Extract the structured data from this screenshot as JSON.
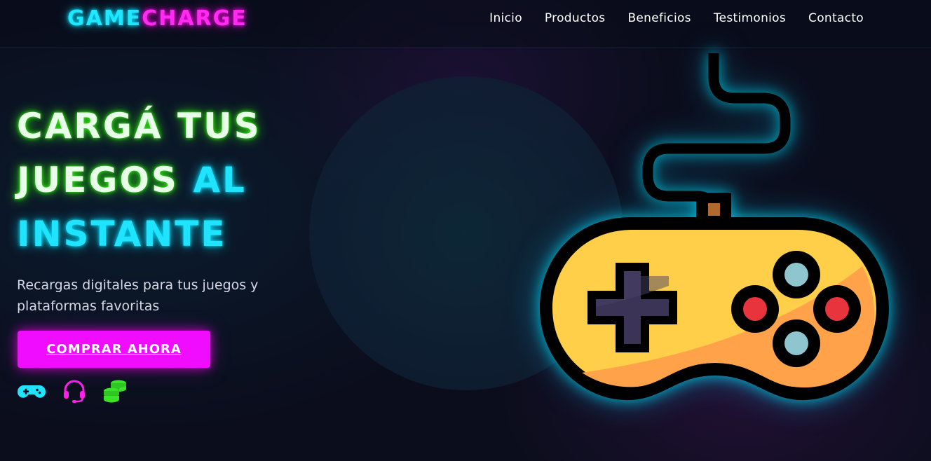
{
  "brand": {
    "part1": "GAME",
    "part2": "CHARGE"
  },
  "nav": {
    "items": [
      "Inicio",
      "Productos",
      "Beneficios",
      "Testimonios",
      "Contacto"
    ]
  },
  "hero": {
    "title_line1": "CARGÁ TUS",
    "title_line2_a": "JUEGOS",
    "title_line2_b": "AL",
    "title_line3": "INSTANTE",
    "subtitle": "Recargas digitales para tus juegos y plataformas favoritas",
    "cta_label": "COMPRAR AHORA",
    "icons": [
      "gamepad-icon",
      "headset-icon",
      "coins-icon"
    ]
  },
  "colors": {
    "cyan": "#00e5ff",
    "magenta": "#ff00ea",
    "green": "#39ff14",
    "background": "#0b0d1c",
    "cta": "#f00cff"
  },
  "illustration": "gamepad-controller-icon"
}
